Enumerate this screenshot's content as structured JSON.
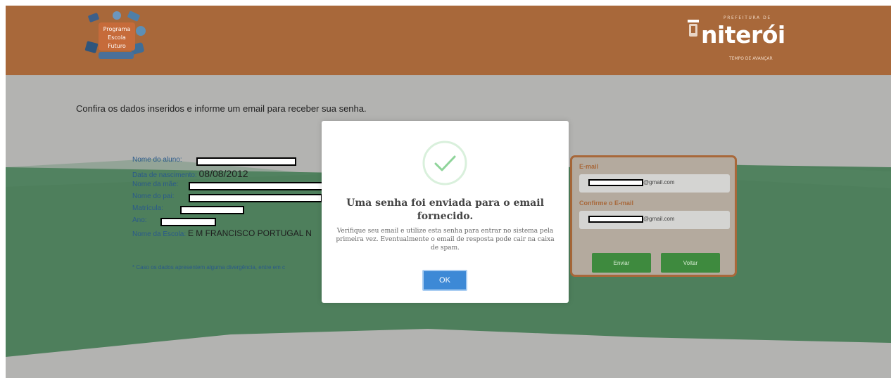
{
  "header": {
    "left_logo_text": [
      "Programa",
      "Escola",
      "Futuro"
    ],
    "brand_top": "PREFEITURA DE",
    "brand_name": "niterói",
    "brand_sub": "TEMPO DE AVANÇAR"
  },
  "main": {
    "instruction": "Confira os dados inseridos e informe um email para receber sua senha.",
    "fields": {
      "nome_aluno": {
        "label": "Nome do aluno:",
        "value": ""
      },
      "data_nascimento": {
        "label": "Data de nascimento:",
        "value": "08/08/2012"
      },
      "nome_mae": {
        "label": "Nome da mãe:",
        "value": ""
      },
      "nome_pai": {
        "label": "Nome do pai:",
        "value": ""
      },
      "matricula": {
        "label": "Matrícula:",
        "value": ""
      },
      "ano": {
        "label": "Ano:",
        "value": ""
      },
      "nome_escola": {
        "label": "Nome da Escola:",
        "value": "E M FRANCISCO PORTUGAL N"
      }
    },
    "note": "* Caso os dados apresentem alguma divergência, entre em c"
  },
  "email_panel": {
    "email_label": "E-mail",
    "email_suffix": "@gmail.com",
    "confirm_label": "Confirme o E-mail",
    "confirm_suffix": "@gmail.com",
    "send_button": "Enviar",
    "back_button": "Voltar"
  },
  "modal": {
    "title": "Uma senha foi enviada para o email fornecido.",
    "text": "Verifique seu email e utilize esta senha para entrar no sistema pela primeira vez. Eventualmente o email de resposta pode cair na caixa de spam.",
    "ok_button": "OK"
  },
  "colors": {
    "header": "#a8683a",
    "green_band": "#4e7f5c",
    "gray": "#b3b3b1",
    "ok_button": "#3d89d6",
    "check": "#8fd49a"
  }
}
